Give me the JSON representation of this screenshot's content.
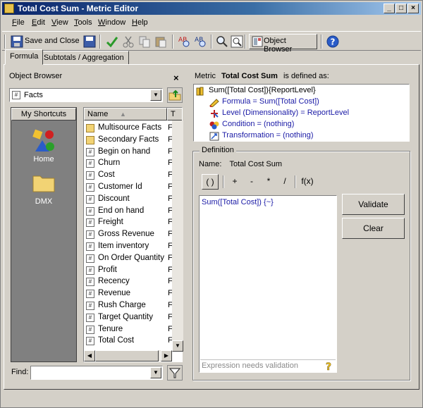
{
  "window": {
    "title": "Total Cost Sum - Metric Editor",
    "controls": [
      "_",
      "□",
      "×"
    ]
  },
  "menubar": {
    "items": [
      {
        "label": "File",
        "key": "F"
      },
      {
        "label": "Edit",
        "key": "E"
      },
      {
        "label": "View",
        "key": "V"
      },
      {
        "label": "Tools",
        "key": "T"
      },
      {
        "label": "Window",
        "key": "W"
      },
      {
        "label": "Help",
        "key": "H"
      }
    ]
  },
  "toolbar": {
    "save_close_label": "Save and Close",
    "object_browser_label": "Object Browser",
    "icons": [
      "save-disk-icon",
      "check-validate-icon",
      "cut-icon",
      "copy-icon",
      "paste-icon",
      "find-object-icon",
      "find-replace-icon",
      "preview-icon",
      "sql-view-icon",
      "object-browser-icon",
      "help-icon"
    ]
  },
  "tabs": [
    {
      "label": "Formula",
      "active": true
    },
    {
      "label": "Subtotals / Aggregation",
      "active": false
    }
  ],
  "object_browser": {
    "title": "Object Browser",
    "folder_combo_value": "Facts",
    "shortcuts_header": "My Shortcuts",
    "shortcuts": [
      {
        "label": "Home",
        "icon": "home-shapes-icon"
      },
      {
        "label": "DMX",
        "icon": "folder-icon"
      }
    ],
    "list_header_name": "Name",
    "list_header_type": "T",
    "items": [
      {
        "label": "Multisource Facts",
        "kind": "folder",
        "t": "F"
      },
      {
        "label": "Secondary Facts",
        "kind": "folder",
        "t": "F"
      },
      {
        "label": "Begin on hand",
        "kind": "fact",
        "t": "F"
      },
      {
        "label": "Churn",
        "kind": "fact",
        "t": "F"
      },
      {
        "label": "Cost",
        "kind": "fact",
        "t": "F"
      },
      {
        "label": "Customer Id",
        "kind": "fact",
        "t": "F"
      },
      {
        "label": "Discount",
        "kind": "fact",
        "t": "F"
      },
      {
        "label": "End on hand",
        "kind": "fact",
        "t": "F"
      },
      {
        "label": "Freight",
        "kind": "fact",
        "t": "F"
      },
      {
        "label": "Gross Revenue",
        "kind": "fact",
        "t": "F"
      },
      {
        "label": "Item inventory",
        "kind": "fact",
        "t": "F"
      },
      {
        "label": "On Order Quantity",
        "kind": "fact",
        "t": "F"
      },
      {
        "label": "Profit",
        "kind": "fact",
        "t": "F"
      },
      {
        "label": "Recency",
        "kind": "fact",
        "t": "F"
      },
      {
        "label": "Revenue",
        "kind": "fact",
        "t": "F"
      },
      {
        "label": "Rush Charge",
        "kind": "fact",
        "t": "F"
      },
      {
        "label": "Target Quantity",
        "kind": "fact",
        "t": "F"
      },
      {
        "label": "Tenure",
        "kind": "fact",
        "t": "F"
      },
      {
        "label": "Total Cost",
        "kind": "fact",
        "t": "F"
      }
    ],
    "find_label": "Find:",
    "find_value": ""
  },
  "metric": {
    "prefix": "Metric",
    "name": "Total Cost Sum",
    "suffix": "is defined as:",
    "tree": [
      {
        "text": "Sum([Total Cost]){ReportLevel}",
        "color": "#000000",
        "icon": "metric-icon"
      },
      {
        "text": "Formula = Sum([Total Cost])",
        "color": "#1a1aa6",
        "icon": "formula-icon"
      },
      {
        "text": "Level (Dimensionality) = ReportLevel",
        "color": "#1a1aa6",
        "icon": "level-icon"
      },
      {
        "text": "Condition = (nothing)",
        "color": "#1a1aa6",
        "icon": "condition-icon"
      },
      {
        "text": "Transformation = (nothing)",
        "color": "#1a1aa6",
        "icon": "transformation-icon"
      }
    ]
  },
  "definition": {
    "group_title": "Definition",
    "name_label": "Name:",
    "name_value": "Total Cost Sum",
    "operators": [
      "( )",
      "+",
      "-",
      "*",
      "/",
      "f(x)"
    ],
    "expression": "Sum([Total Cost]) {~}",
    "status": "Expression needs validation",
    "validate_label": "Validate",
    "clear_label": "Clear"
  },
  "colors": {
    "title_gradient_start": "#0a246a",
    "link_blue": "#1a1aa6",
    "face": "#d4d0c8"
  }
}
